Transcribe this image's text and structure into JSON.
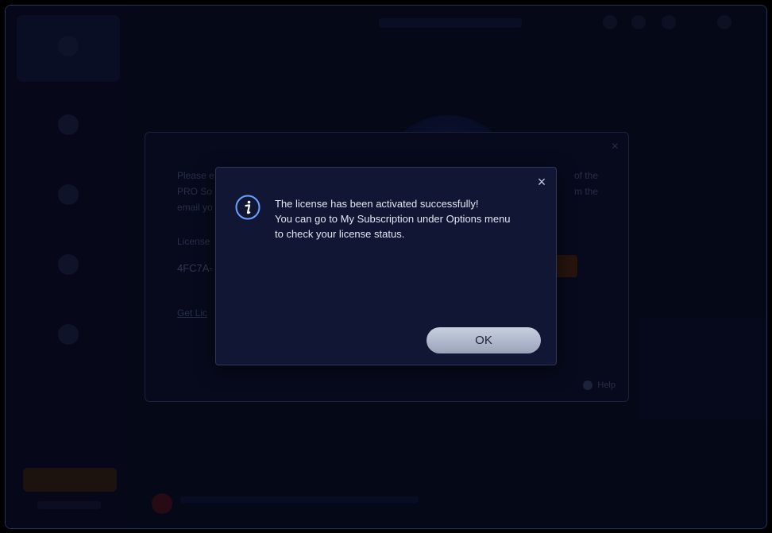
{
  "message_dialog": {
    "lines": [
      "The license has been activated successfully!",
      "You can go to My Subscription under Options menu",
      "to check your license status."
    ],
    "ok_label": "OK",
    "close_glyph": "×",
    "icon": "info-icon"
  },
  "license_dialog": {
    "text_line1_start": "Please e",
    "text_line1_end": "of the",
    "text_line2_start": "PRO So",
    "text_line2_end": "m the",
    "text_line3_start": "email yo",
    "label": "License",
    "key_value": "4FC7A-",
    "link_text": "Get Lic",
    "help_label": "Help",
    "close_glyph": "×"
  },
  "colors": {
    "dialog_bg": "#111634",
    "ok_button": "#b7bfd2",
    "info_accent": "#6aa3ff"
  }
}
